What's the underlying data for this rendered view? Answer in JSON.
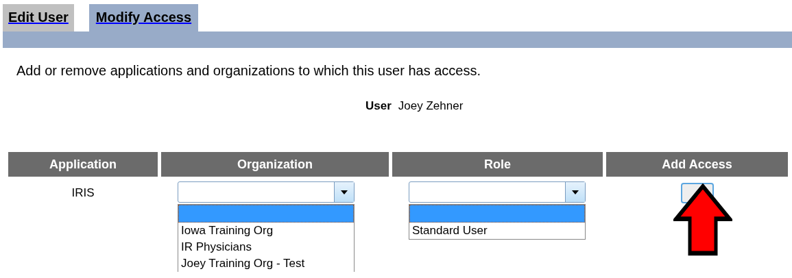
{
  "tabs": [
    {
      "label": "Edit User",
      "selected": false
    },
    {
      "label": "Modify Access",
      "selected": true
    }
  ],
  "intro": "Add or remove applications and organizations to which this user has access.",
  "user": {
    "label": "User",
    "value": "Joey Zehner"
  },
  "table": {
    "columns": [
      "Application",
      "Organization",
      "Role",
      "Add Access"
    ],
    "row": {
      "application": "IRIS",
      "organization": {
        "options": [
          {
            "selected": true
          },
          {
            "label": "Iowa Training Org",
            "selected": false
          },
          {
            "label": "IR Physicians",
            "selected": false
          },
          {
            "label": "Joey Training Org - Test",
            "selected": false
          }
        ]
      },
      "role": {
        "options": [
          {
            "selected": true
          },
          {
            "label": "Standard User",
            "selected": false
          }
        ]
      }
    }
  }
}
